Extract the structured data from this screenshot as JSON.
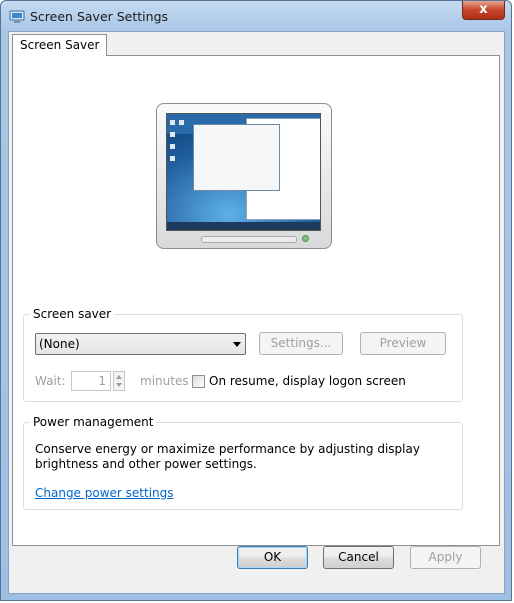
{
  "window": {
    "title": "Screen Saver Settings",
    "close_label": "x"
  },
  "tabs": [
    {
      "label": "Screen Saver"
    }
  ],
  "screen_saver": {
    "group_title": "Screen saver",
    "selected": "(None)",
    "settings_label": "Settings...",
    "preview_label": "Preview",
    "wait_label": "Wait:",
    "wait_value": "1",
    "minutes_label": "minutes",
    "resume_label": "On resume, display logon screen",
    "resume_checked": false
  },
  "power": {
    "group_title": "Power management",
    "description": "Conserve energy or maximize performance by adjusting display brightness and other power settings.",
    "link_label": "Change power settings"
  },
  "buttons": {
    "ok": "OK",
    "cancel": "Cancel",
    "apply": "Apply"
  }
}
